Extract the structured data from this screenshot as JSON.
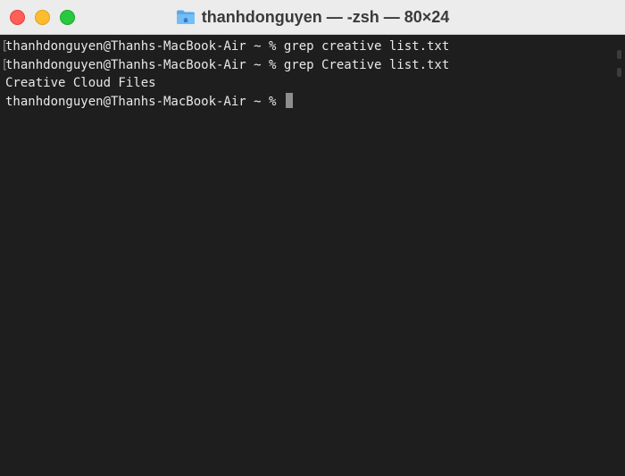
{
  "window": {
    "title": "thanhdonguyen — -zsh — 80×24",
    "folder_icon": "folder-home-icon",
    "controls": {
      "close": "close-button",
      "minimize": "minimize-button",
      "zoom": "zoom-button"
    }
  },
  "terminal": {
    "lines": [
      {
        "text": "thanhdonguyen@Thanhs-MacBook-Air ~ % grep creative list.txt",
        "marked": true
      },
      {
        "text": "thanhdonguyen@Thanhs-MacBook-Air ~ % grep Creative list.txt",
        "marked": true
      },
      {
        "text": "Creative Cloud Files",
        "marked": false
      },
      {
        "text": "thanhdonguyen@Thanhs-MacBook-Air ~ % ",
        "marked": false
      }
    ],
    "mark_glyph": "["
  },
  "colors": {
    "background": "#1e1e1e",
    "text": "#e8e8e8",
    "titlebar": "#ececec",
    "close": "#ff5f57",
    "minimize": "#febc2e",
    "zoom": "#28c840",
    "cursor": "#8e8e8e"
  }
}
